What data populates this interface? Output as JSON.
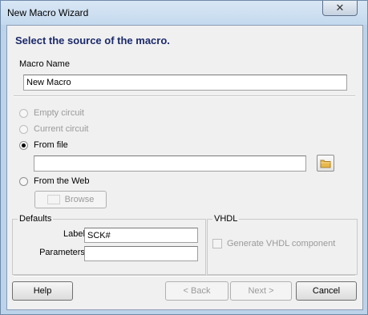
{
  "window": {
    "title": "New Macro Wizard",
    "close_glyph": "✕"
  },
  "heading": "Select the source of the macro.",
  "macro_name": {
    "label": "Macro Name",
    "value": "New Macro"
  },
  "source_options": [
    {
      "label": "Empty circuit",
      "enabled": false,
      "checked": false
    },
    {
      "label": "Current circuit",
      "enabled": false,
      "checked": false
    },
    {
      "label": "From file",
      "enabled": true,
      "checked": true
    },
    {
      "label": "From the Web",
      "enabled": true,
      "checked": false
    }
  ],
  "file_path": {
    "value": ""
  },
  "browse_label": "Browse",
  "defaults": {
    "title": "Defaults",
    "label_caption": "Label:",
    "label_value": "SCK#",
    "parameters_caption": "Parameters:",
    "parameters_value": ""
  },
  "vhdl": {
    "title": "VHDL",
    "generate_label": "Generate VHDL component",
    "generate_checked": false
  },
  "buttons": {
    "help": "Help",
    "back": "< Back",
    "next": "Next >",
    "cancel": "Cancel"
  },
  "colors": {
    "heading": "#1b2a6b",
    "folder_icon": "#e8b84a"
  }
}
